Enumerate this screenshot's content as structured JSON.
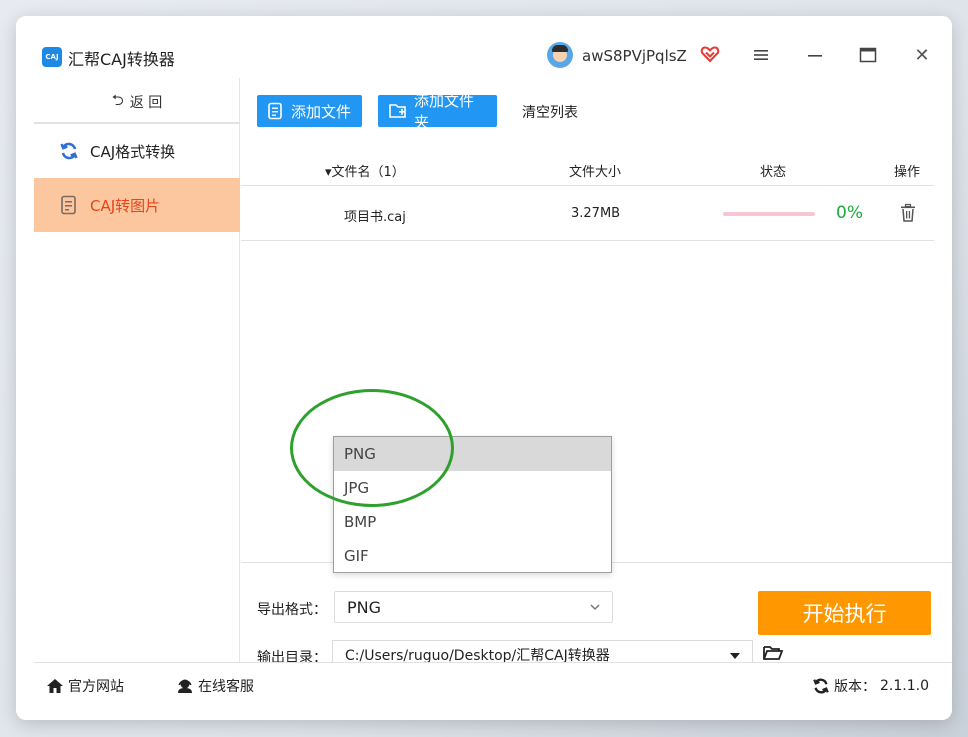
{
  "app": {
    "title": "汇帮CAJ转换器",
    "logo_text": "CAJ",
    "username": "awS8PVjPqlsZ"
  },
  "sidebar": {
    "back_label": "返  回",
    "items": [
      {
        "label": "CAJ格式转换",
        "icon": "refresh-icon",
        "active": false
      },
      {
        "label": "CAJ转图片",
        "icon": "document-icon",
        "active": true
      }
    ]
  },
  "toolbar": {
    "add_file_label": "添加文件",
    "add_folder_label": "添加文件夹",
    "clear_label": "清空列表"
  },
  "table": {
    "columns": [
      "▾文件名（1）",
      "文件大小",
      "状态",
      "操作"
    ],
    "rows": [
      {
        "name": "项目书.caj",
        "size": "3.27MB",
        "progress": 0,
        "progress_text": "0%"
      }
    ]
  },
  "settings": {
    "format_label": "导出格式：",
    "format_value": "PNG",
    "format_options": [
      "PNG",
      "JPG",
      "BMP",
      "GIF"
    ],
    "dir_label": "输出目录：",
    "dir_value": "C:/Users/ruguo/Desktop/汇帮CAJ转换器",
    "start_label": "开始执行"
  },
  "footer": {
    "site_label": "官方网站",
    "service_label": "在线客服",
    "version_label": "版本：",
    "version_value": "2.1.1.0"
  },
  "colors": {
    "primary_blue": "#2196f3",
    "accent_orange": "#ff9800",
    "active_sidebar_bg": "#fcc79e",
    "active_sidebar_text": "#e8431a",
    "success_green": "#1eaa3b",
    "highlight_ring": "#2ea02e"
  }
}
